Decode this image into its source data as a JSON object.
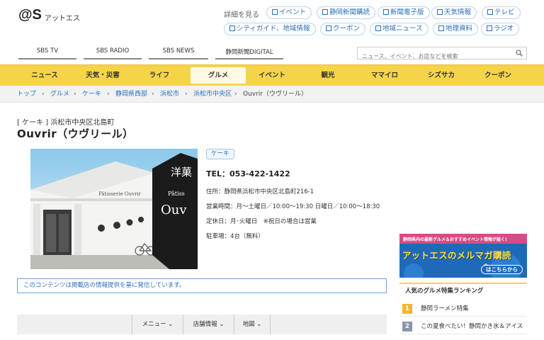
{
  "site": {
    "logo_mark": "@S",
    "logo_text": "アットエス",
    "more_label": "詳細を見る",
    "top_links": [
      "イベント",
      "静岡新聞購読",
      "新聞電子版",
      "天気情報",
      "テレビ",
      "シティガイド、地域情報",
      "クーポン",
      "地域ニュース",
      "地理資料",
      "ラジオ"
    ],
    "media_tabs": [
      "SBS TV",
      "SBS RADIO",
      "SBS NEWS",
      "静岡新聞DIGITAL"
    ],
    "search_placeholder": "ニュース、イベント、お店などを検索"
  },
  "gnav": {
    "items": [
      "ニュース",
      "天気・災害",
      "ライフ",
      "グルメ",
      "イベント",
      "観光",
      "ママイロ",
      "シズサカ",
      "クーポン"
    ],
    "active": "グルメ"
  },
  "breadcrumb": [
    "トップ",
    "グルメ",
    "ケーキ",
    "静岡県西部",
    "浜松市",
    "浜松市中央区",
    "Ouvrir（ウヴリール）"
  ],
  "shop": {
    "category_line": "[ ケーキ ] 浜松市中央区北島町",
    "name": "Ouvrir（ウヴリール）",
    "photo_sign_top": "洋菓",
    "photo_sign_mid": "Pâtiss",
    "photo_sign_big": "Ouv",
    "photo_wall_text": "Pâtisserie Ouvrir",
    "badge": "ケーキ",
    "tel": "TEL：053-422-1422",
    "address": "住所：静岡県浜松市中央区北島町216-1",
    "hours": "営業時間：月〜土曜日／10:00〜19:30 日曜日／10:00〜18:30",
    "closed": "定休日：月･火曜日　※祝日の場合は営業",
    "parking": "駐車場：4台（無料）",
    "notice": "このコンテンツは掲載店の情報提供を基に発信しています。"
  },
  "subtabs": [
    "メニュー",
    "店舗情報",
    "地図"
  ],
  "sidebar": {
    "banner_top": "静岡県内の最新グルメ＆おすすめイベント情報が届く!",
    "banner_main": "アットエスのメルマガ購読",
    "banner_button": "はこちらから",
    "ranking_title": "人気のグルメ特集ランキング",
    "ranking": [
      {
        "rank": "1",
        "label": "静岡ラーメン特集"
      },
      {
        "rank": "2",
        "label": "この夏食べたい！静岡かき氷＆アイス"
      }
    ]
  },
  "colors": {
    "nav_yellow": "#f5d44a",
    "link_blue": "#2a6fb8",
    "rank1": "#f2b632",
    "rank2": "#8a96a8"
  }
}
